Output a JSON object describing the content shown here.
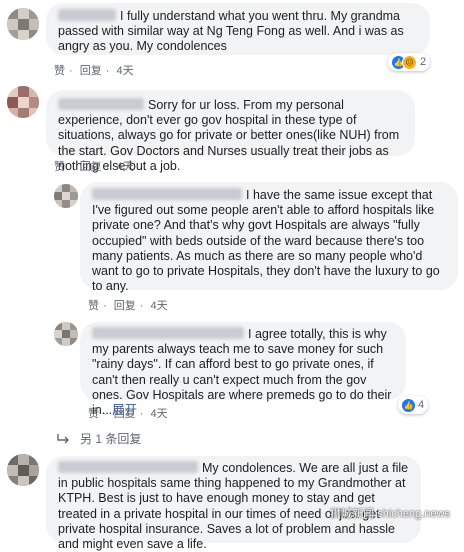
{
  "comments": [
    {
      "text": "I fully understand what you went thru. My grandma passed with similar way at Ng Teng Fong as well. And i was as angry as you. My condolences",
      "actions": {
        "like": "赞",
        "reply": "回复",
        "time": "4天"
      },
      "reaction_count": "2"
    },
    {
      "text": "Sorry for ur loss. From my personal experience, don't ever go gov hospital in these type of situations, always go for private or better ones(like NUH) from the start. Gov Doctors and Nurses usually treat their jobs as nothing else but a job.",
      "actions": {
        "like": "赞",
        "reply": "回复",
        "time": "4天"
      }
    }
  ],
  "replies": [
    {
      "text": "I have the same issue except that I've figured out some people aren't able to afford hospitals like private one? And that's why govt Hospitals are always \"fully occupied\" with beds outside of the ward because there's too many patients. As much as there are so many people who'd want to go to private Hospitals, they don't have the luxury to go to any.",
      "actions": {
        "like": "赞",
        "reply": "回复",
        "time": "4天"
      }
    },
    {
      "text": "I agree totally, this is why my parents always teach me to save money for such \"rainy days\". If can afford best to go private ones, if can't then really u can't expect much from the gov ones. Gov Hospitals are where premeds go to do their in...",
      "see_more": "展开",
      "actions": {
        "like": "赞",
        "reply": "回复",
        "time": "4天"
      },
      "reaction_count": "4"
    }
  ],
  "more_replies": "另 1 条回复",
  "last_comment": {
    "text": "My condolences. We are all just a file in public hospitals same thing happened to my Grandmother at KTPH. Best is just to have enough money to stay and get treated in a private hospital in our times of need or just get private hospital insurance. Saves a lot of problem and hassle and might even save a life."
  },
  "watermark": "狮城新闻 shicheng.news"
}
